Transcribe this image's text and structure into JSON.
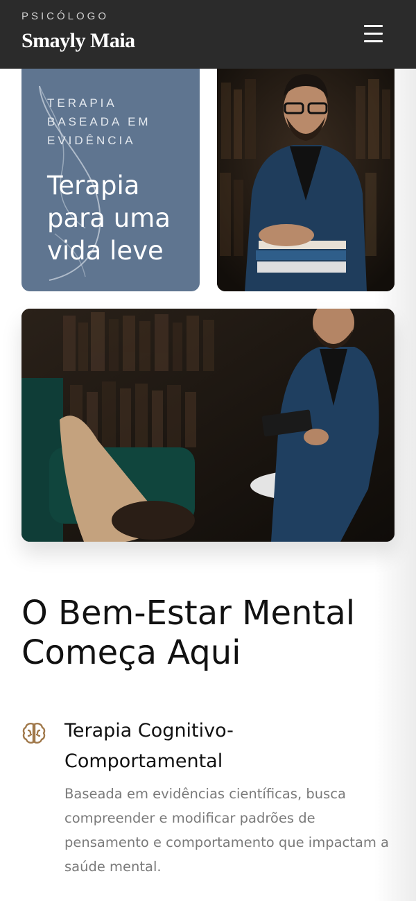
{
  "header": {
    "kicker": "PSICÓLOGO",
    "brand": "Smayly Maia",
    "menu_icon": "hamburger-menu-icon"
  },
  "hero": {
    "card": {
      "kicker": "TERAPIA BASEADA EM EVIDÊNCIA",
      "title": "Terapia para uma vida leve",
      "background_color": "#5f7590"
    },
    "photos": [
      {
        "description_icon": "portrait-photo"
      },
      {
        "description_icon": "therapy-session-photo"
      }
    ]
  },
  "section": {
    "headline": "O Bem-Estar Mental Começa Aqui"
  },
  "services": [
    {
      "icon": "brain-icon",
      "icon_color": "#a0784a",
      "title": "Terapia Cognitivo-Comportamental",
      "description": "Baseada em evidências científicas, busca compreender e modificar padrões de pensamento e comportamento que impactam a saúde mental."
    }
  ],
  "colors": {
    "header_bg": "#2b2b2b",
    "accent": "#a0784a"
  }
}
